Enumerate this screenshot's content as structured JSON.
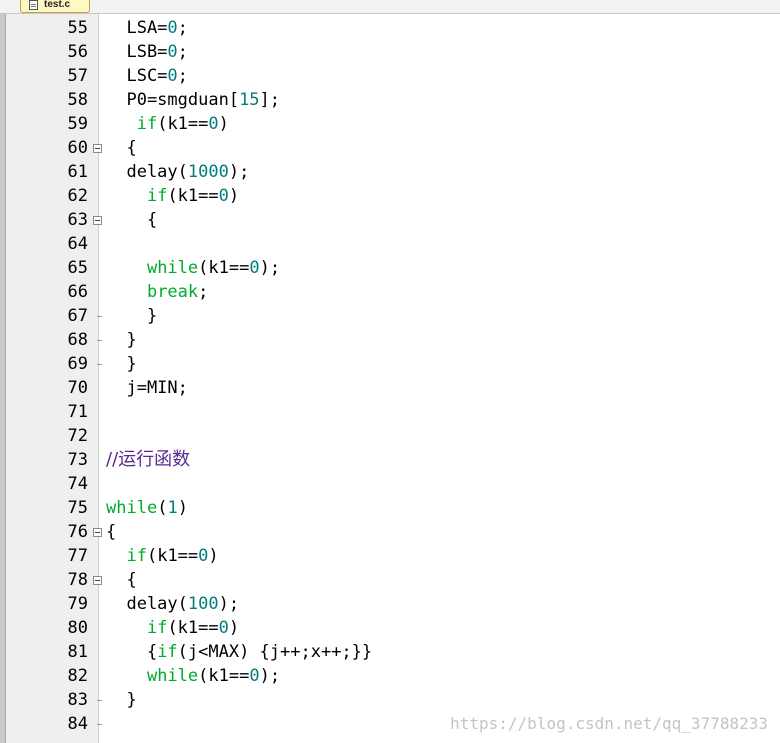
{
  "tab": {
    "label": "test.c"
  },
  "lines": [
    {
      "num": "55",
      "fold": "",
      "segments": [
        {
          "t": "  LSA="
        },
        {
          "t": "0",
          "c": "num"
        },
        {
          "t": ";"
        }
      ]
    },
    {
      "num": "56",
      "fold": "",
      "segments": [
        {
          "t": "  LSB="
        },
        {
          "t": "0",
          "c": "num"
        },
        {
          "t": ";"
        }
      ]
    },
    {
      "num": "57",
      "fold": "",
      "segments": [
        {
          "t": "  LSC="
        },
        {
          "t": "0",
          "c": "num"
        },
        {
          "t": ";"
        }
      ]
    },
    {
      "num": "58",
      "fold": "",
      "segments": [
        {
          "t": "  P0=smgduan["
        },
        {
          "t": "15",
          "c": "num"
        },
        {
          "t": "];"
        }
      ]
    },
    {
      "num": "59",
      "fold": "",
      "segments": [
        {
          "t": "   "
        },
        {
          "t": "if",
          "c": "kw"
        },
        {
          "t": "(k1=="
        },
        {
          "t": "0",
          "c": "num"
        },
        {
          "t": ")"
        }
      ]
    },
    {
      "num": "60",
      "fold": "box",
      "segments": [
        {
          "t": "  {"
        }
      ]
    },
    {
      "num": "61",
      "fold": "",
      "segments": [
        {
          "t": "  delay("
        },
        {
          "t": "1000",
          "c": "num"
        },
        {
          "t": ");"
        }
      ]
    },
    {
      "num": "62",
      "fold": "",
      "segments": [
        {
          "t": "    "
        },
        {
          "t": "if",
          "c": "kw"
        },
        {
          "t": "(k1=="
        },
        {
          "t": "0",
          "c": "num"
        },
        {
          "t": ")"
        }
      ]
    },
    {
      "num": "63",
      "fold": "box",
      "segments": [
        {
          "t": "    {"
        }
      ]
    },
    {
      "num": "64",
      "fold": "",
      "segments": [
        {
          "t": ""
        }
      ]
    },
    {
      "num": "65",
      "fold": "",
      "segments": [
        {
          "t": "    "
        },
        {
          "t": "while",
          "c": "kw"
        },
        {
          "t": "(k1=="
        },
        {
          "t": "0",
          "c": "num"
        },
        {
          "t": ");"
        }
      ]
    },
    {
      "num": "66",
      "fold": "",
      "segments": [
        {
          "t": "    "
        },
        {
          "t": "break",
          "c": "kw"
        },
        {
          "t": ";"
        }
      ]
    },
    {
      "num": "67",
      "fold": "end",
      "segments": [
        {
          "t": "    }"
        }
      ]
    },
    {
      "num": "68",
      "fold": "end",
      "segments": [
        {
          "t": "  }"
        }
      ]
    },
    {
      "num": "69",
      "fold": "end",
      "segments": [
        {
          "t": "  }"
        }
      ]
    },
    {
      "num": "70",
      "fold": "",
      "segments": [
        {
          "t": "  j=MIN;"
        }
      ]
    },
    {
      "num": "71",
      "fold": "",
      "segments": [
        {
          "t": ""
        }
      ]
    },
    {
      "num": "72",
      "fold": "",
      "segments": [
        {
          "t": ""
        }
      ]
    },
    {
      "num": "73",
      "fold": "",
      "segments": [
        {
          "t": "//运行函数",
          "c": "comment"
        }
      ]
    },
    {
      "num": "74",
      "fold": "",
      "segments": [
        {
          "t": ""
        }
      ]
    },
    {
      "num": "75",
      "fold": "",
      "segments": [
        {
          "t": "while",
          "c": "kw"
        },
        {
          "t": "("
        },
        {
          "t": "1",
          "c": "num"
        },
        {
          "t": ")"
        }
      ]
    },
    {
      "num": "76",
      "fold": "box",
      "segments": [
        {
          "t": "{"
        }
      ]
    },
    {
      "num": "77",
      "fold": "",
      "segments": [
        {
          "t": "  "
        },
        {
          "t": "if",
          "c": "kw"
        },
        {
          "t": "(k1=="
        },
        {
          "t": "0",
          "c": "num"
        },
        {
          "t": ")"
        }
      ]
    },
    {
      "num": "78",
      "fold": "box",
      "segments": [
        {
          "t": "  {"
        }
      ]
    },
    {
      "num": "79",
      "fold": "",
      "segments": [
        {
          "t": "  delay("
        },
        {
          "t": "100",
          "c": "num"
        },
        {
          "t": ");"
        }
      ]
    },
    {
      "num": "80",
      "fold": "",
      "segments": [
        {
          "t": "    "
        },
        {
          "t": "if",
          "c": "kw"
        },
        {
          "t": "(k1=="
        },
        {
          "t": "0",
          "c": "num"
        },
        {
          "t": ")"
        }
      ]
    },
    {
      "num": "81",
      "fold": "",
      "segments": [
        {
          "t": "    {"
        },
        {
          "t": "if",
          "c": "kw"
        },
        {
          "t": "(j<MAX) {j++;x++;}}"
        }
      ]
    },
    {
      "num": "82",
      "fold": "",
      "segments": [
        {
          "t": "    "
        },
        {
          "t": "while",
          "c": "kw"
        },
        {
          "t": "(k1=="
        },
        {
          "t": "0",
          "c": "num"
        },
        {
          "t": ");"
        }
      ]
    },
    {
      "num": "83",
      "fold": "end",
      "segments": [
        {
          "t": "  }"
        }
      ]
    },
    {
      "num": "84",
      "fold": "end",
      "segments": [
        {
          "t": ""
        }
      ]
    }
  ],
  "watermark": "https://blog.csdn.net/qq_37788233"
}
